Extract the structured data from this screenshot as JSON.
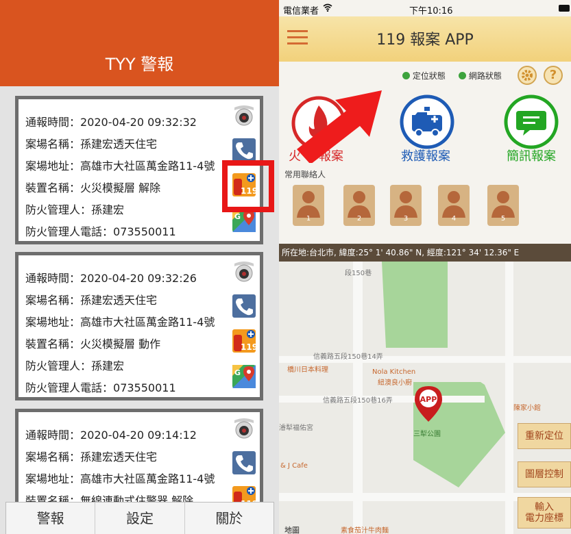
{
  "left": {
    "title": "TYY 警報",
    "cards": [
      {
        "time_label": "通報時間：",
        "time": "2020-04-20 09:32:32",
        "site_label": "案場名稱：",
        "site": "孫建宏透天住宅",
        "address_label": "案場地址：",
        "address": "高雄市大社區萬金路11-4號",
        "device_label": "裝置名稱：",
        "device": "火災模擬層 解除",
        "manager_label": "防火管理人：",
        "manager": "孫建宏",
        "phone_label": "防火管理人電話：",
        "phone": "073550011"
      },
      {
        "time_label": "通報時間：",
        "time": "2020-04-20 09:32:26",
        "site_label": "案場名稱：",
        "site": "孫建宏透天住宅",
        "address_label": "案場地址：",
        "address": "高雄市大社區萬金路11-4號",
        "device_label": "裝置名稱：",
        "device": "火災模擬層 動作",
        "manager_label": "防火管理人：",
        "manager": "孫建宏",
        "phone_label": "防火管理人電話：",
        "phone": "073550011"
      },
      {
        "time_label": "通報時間：",
        "time": "2020-04-20 09:14:12",
        "site_label": "案場名稱：",
        "site": "孫建宏透天住宅",
        "address_label": "案場地址：",
        "address": "高雄市大社區萬金路11-4號",
        "device_label": "裝置名稱：",
        "device": "無線連動式住警器 解除"
      }
    ],
    "icon_119_text": "119",
    "tabs": [
      "警報",
      "設定",
      "關於"
    ]
  },
  "right": {
    "status": {
      "carrier": "電信業者",
      "time": "下午10:16"
    },
    "app_title": "119 報案 APP",
    "indicators": {
      "location": "定位狀態",
      "network": "網路狀態"
    },
    "question_mark": "?",
    "buttons": {
      "fire": "火災報案",
      "fire_partial": "火",
      "fire_visible": "報案",
      "ambulance": "救護報案",
      "sms": "簡訊報案"
    },
    "contacts_label": "常用聯絡人",
    "contacts": [
      "1",
      "2",
      "3",
      "4",
      "5"
    ],
    "location_info": "所在地:台北市, 緯度:25° 1' 40.86\" N, 經度:121° 34' 12.36\" E",
    "map": {
      "road_1": "信義路五段150巷14弄",
      "road_2": "信義路五段150巷16弄",
      "road_vertical": "段150巷",
      "restaurant": "橋川日本料理",
      "kitchen_1": "Nola Kitchen",
      "kitchen_2": "紐澳良小廚",
      "park": "三犁公園",
      "shrine": "濬犁福佑宮",
      "cafe": "& J Cafe",
      "chen": "陳家小館",
      "beef": "素食茄汁牛肉麵",
      "attribution": "地圖",
      "pin": "APP"
    },
    "map_buttons": {
      "relocate": "重新定位",
      "layers": "圖層控制",
      "coord_1": "輸入",
      "coord_2": "電力座標"
    }
  },
  "colors": {
    "alarm_header": "#d9541f",
    "highlight": "#e81717",
    "fire": "#d62828",
    "ambulance": "#1e5bb5",
    "sms": "#23a623",
    "park": "#a7d59a"
  }
}
